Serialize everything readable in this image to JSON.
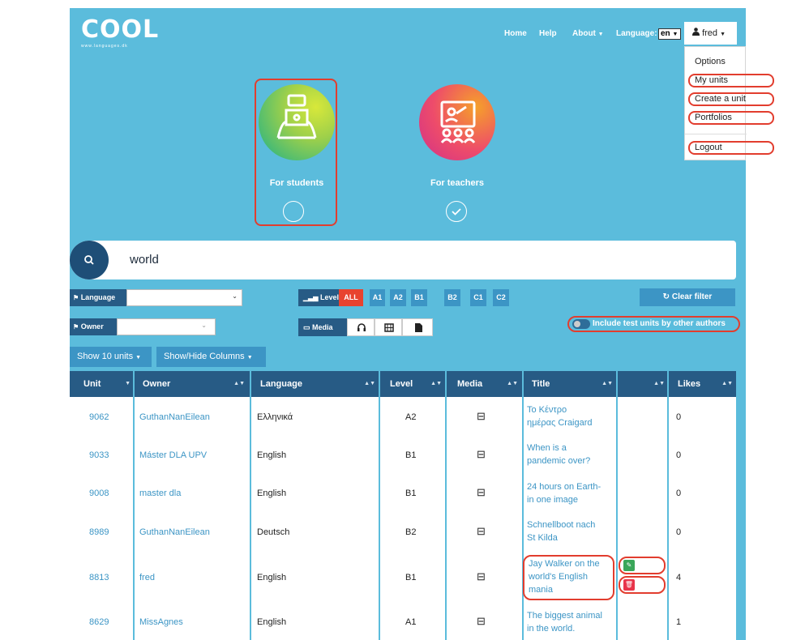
{
  "header": {
    "logo_text": "COOL",
    "logo_sub": "www.languages.dk",
    "nav": {
      "home": "Home",
      "help": "Help",
      "about": "About",
      "language_label": "Language:",
      "language_value": "en",
      "user": "fred"
    }
  },
  "user_menu": {
    "items": [
      "Options",
      "My units",
      "Create a unit",
      "Portfolios",
      "Logout"
    ]
  },
  "roles": {
    "students": "For students",
    "teachers": "For teachers"
  },
  "search": {
    "value": "world"
  },
  "filters": {
    "language_label": "Language",
    "owner_label": "Owner",
    "level_label": "Level",
    "levels": [
      "ALL",
      "A1",
      "A2",
      "B1",
      "B2",
      "C1",
      "C2"
    ],
    "media_label": "Media",
    "clear_label": "Clear filter",
    "include_test_label": "Include test units by other authors"
  },
  "table_controls": {
    "show_units": "Show 10 units",
    "show_hide_columns": "Show/Hide Columns"
  },
  "table": {
    "headers": [
      "Unit",
      "Owner",
      "Language",
      "Level",
      "Media",
      "Title",
      "",
      "Likes"
    ],
    "rows": [
      {
        "unit": "9062",
        "owner": "GuthanNanEilean",
        "language": "Ελληνικά",
        "level": "A2",
        "title": [
          "Το Κέντρο",
          "ημέρας Craigard"
        ],
        "likes": "0"
      },
      {
        "unit": "9033",
        "owner": "Máster DLA UPV",
        "language": "English",
        "level": "B1",
        "title": [
          "When is a",
          "pandemic over?"
        ],
        "likes": "0"
      },
      {
        "unit": "9008",
        "owner": "master dla",
        "language": "English",
        "level": "B1",
        "title": [
          "24 hours on Earth-",
          "in one image"
        ],
        "likes": "0"
      },
      {
        "unit": "8989",
        "owner": "GuthanNanEilean",
        "language": "Deutsch",
        "level": "B2",
        "title": [
          "Schnellboot nach",
          "St Kilda"
        ],
        "likes": "0"
      },
      {
        "unit": "8813",
        "owner": "fred",
        "language": "English",
        "level": "B1",
        "title": [
          "Jay Walker on the",
          "world's English",
          "mania"
        ],
        "likes": "4"
      },
      {
        "unit": "8629",
        "owner": "MissAgnes",
        "language": "English",
        "level": "A1",
        "title": [
          "The biggest animal",
          "in the world."
        ],
        "likes": "1"
      }
    ]
  },
  "colors": {
    "background": "#5bbcdc",
    "header_dark": "#275b85",
    "accent_blue": "#3c95c5",
    "active_red": "#e8432f",
    "highlight_red": "#e23d2e",
    "edit_green": "#3aa65a",
    "delete_red": "#e8344a"
  },
  "icons": [
    "search-icon",
    "film-icon",
    "headphones-icon",
    "file-icon",
    "monitor-icon",
    "bar-chart-icon",
    "refresh-icon",
    "user-icon",
    "flag-icon",
    "edit-icon",
    "trash-icon",
    "check-icon"
  ]
}
